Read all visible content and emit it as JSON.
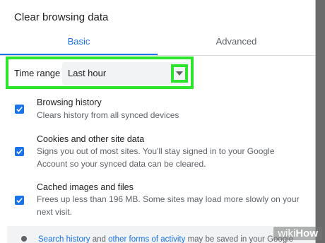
{
  "dialog": {
    "title": "Clear browsing data",
    "tabs": [
      {
        "label": "Basic",
        "active": true
      },
      {
        "label": "Advanced",
        "active": false
      }
    ]
  },
  "time_range": {
    "label": "Time range",
    "selected": "Last hour"
  },
  "items": [
    {
      "title": "Browsing history",
      "description": "Clears history from all synced devices",
      "checked": true
    },
    {
      "title": "Cookies and other site data",
      "description": "Signs you out of most sites. You'll stay signed in to your Google Account so your synced data can be cleared.",
      "checked": true
    },
    {
      "title": "Cached images and files",
      "description": "Frees up less than 196 MB. Some sites may load more slowly on your next visit.",
      "checked": true
    }
  ],
  "footer": {
    "link1": "Search history",
    "text1": " and ",
    "link2": "other forms of activity",
    "text2": " may be saved in your Google"
  },
  "watermark": {
    "wiki": "wiki",
    "how": "How"
  },
  "colors": {
    "accent": "#1a73e8",
    "highlight": "#2ee52e"
  }
}
